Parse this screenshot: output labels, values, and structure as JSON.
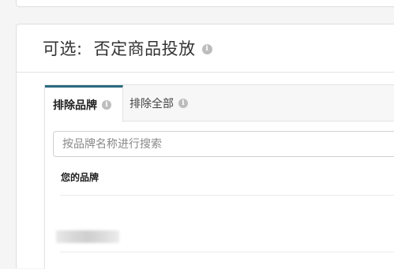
{
  "header": {
    "label": "可选:",
    "title": "否定商品投放"
  },
  "tabs": [
    {
      "label": "排除品牌",
      "active": true
    },
    {
      "label": "排除全部",
      "active": false
    }
  ],
  "search": {
    "placeholder": "按品牌名称进行搜索",
    "value": ""
  },
  "brands": {
    "column_header": "您的品牌"
  },
  "icons": {
    "info": "i"
  },
  "colors": {
    "active_tab_accent": "#2a6a7f",
    "info_icon": "#bdbdbd"
  }
}
